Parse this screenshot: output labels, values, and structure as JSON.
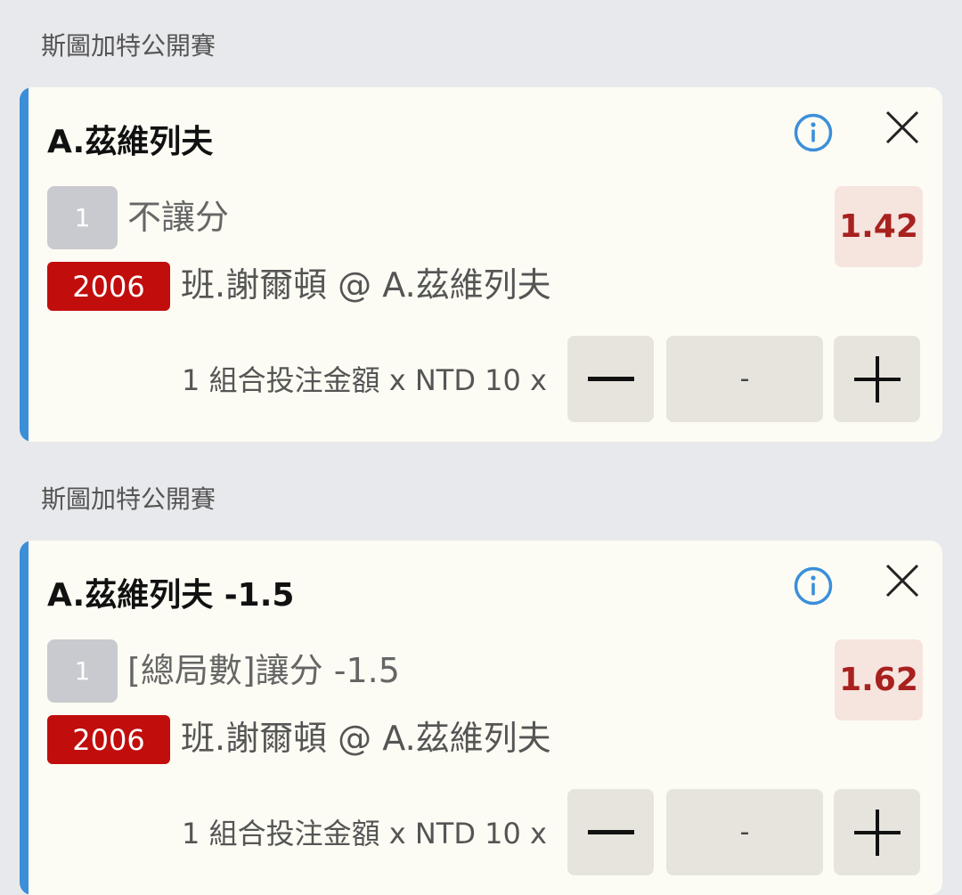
{
  "bets": [
    {
      "league": "斯圖加特公開賽",
      "selection": "A.茲維列夫",
      "leg_number": "1",
      "market": "不讓分",
      "odds": "1.42",
      "match_code": "2006",
      "match": "班.謝爾頓 @ A.茲維列夫",
      "stake_label": "1 組合投注金額 x NTD 10 x",
      "stake_value": "-"
    },
    {
      "league": "斯圖加特公開賽",
      "selection": "A.茲維列夫 -1.5",
      "leg_number": "1",
      "market": "[總局數]讓分 -1.5",
      "odds": "1.62",
      "match_code": "2006",
      "match": "班.謝爾頓 @ A.茲維列夫",
      "stake_label": "1 組合投注金額 x NTD 10 x",
      "stake_value": "-"
    }
  ],
  "colors": {
    "accent": "#3b8fd9",
    "odds_text": "#a8211e",
    "odds_bg": "#f6e4df",
    "match_code_bg": "#c10d0c"
  },
  "icons": {
    "info": "info-icon",
    "close": "close-icon",
    "minus": "minus-icon",
    "plus": "plus-icon"
  }
}
